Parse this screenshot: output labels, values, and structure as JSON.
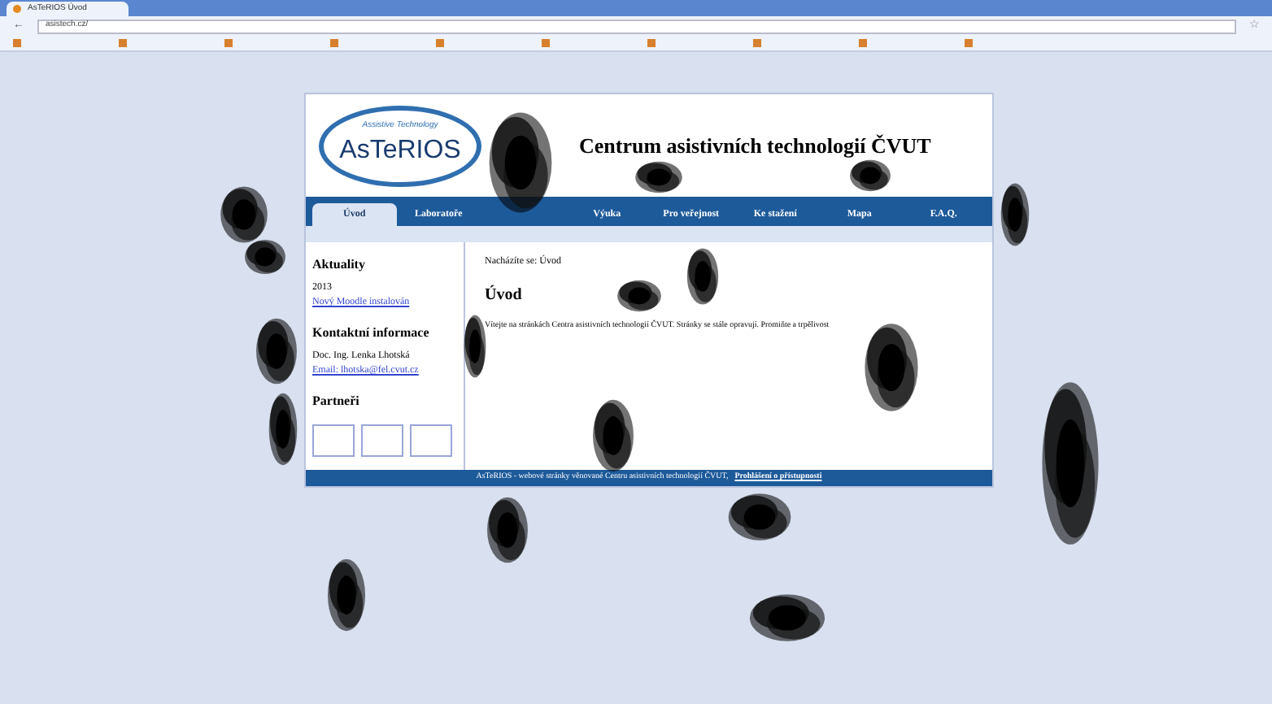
{
  "browser": {
    "tab_title": "AsTeRIOS Úvod",
    "url": "asistech.cz/",
    "back": "←",
    "bookmark_star": "☆"
  },
  "site": {
    "logo": "AsTeRIOS",
    "logo_arc": "Assistive Technology",
    "header_title": "Centrum asistivních technologií ČVUT",
    "nav": [
      {
        "label": "Úvod",
        "selected": true
      },
      {
        "label": "Laboratoře",
        "selected": false
      },
      {
        "selected": false
      },
      {
        "label": "Výuka",
        "selected": false
      },
      {
        "label": "Pro veřejnost",
        "selected": false
      },
      {
        "label": "Ke stažení",
        "selected": false
      },
      {
        "label": "Mapa",
        "selected": false
      },
      {
        "label": "F.A.Q.",
        "selected": false
      }
    ],
    "sidebar": [
      {
        "kind": "heading",
        "text": "Aktuality"
      },
      {
        "kind": "text",
        "text": "2013"
      },
      {
        "kind": "link",
        "text": "Nový Moodle instalován"
      },
      {
        "kind": "heading",
        "text": "Kontaktní informace"
      },
      {
        "kind": "text",
        "text": "Doc. Ing. Lenka Lhotská"
      },
      {
        "kind": "link",
        "text": "Email: lhotska@fel.cvut.cz"
      },
      {
        "kind": "heading",
        "text": "Partneři"
      },
      {
        "kind": "logos"
      }
    ],
    "breadcrumb": "Nacházíte se: Úvod",
    "heading": "Úvod",
    "intro": "Vítejte na stránkách Centra asistivních technologií ČVUT. Stránky se stále opravují. Promiňte a trpělivost",
    "footer_text": "AsTeRIOS - webové stránky věnované Centru asistivních technologií ČVUT,",
    "footer_link": "Prohlášení o přístupnosti"
  }
}
